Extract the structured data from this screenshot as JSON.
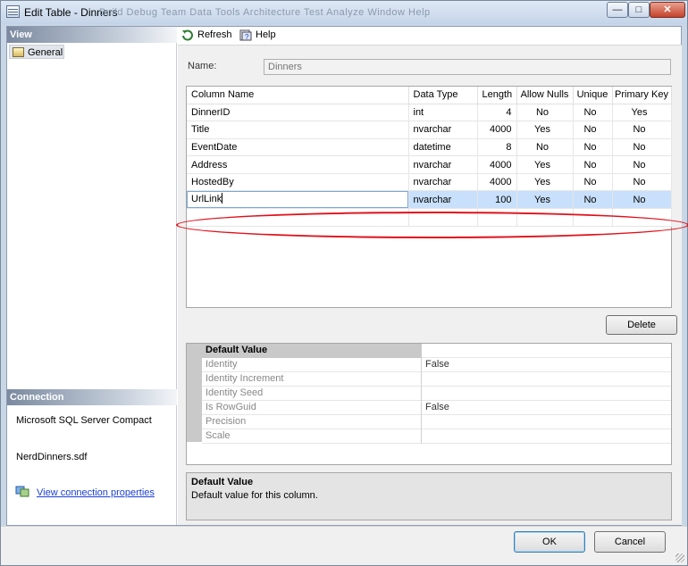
{
  "window": {
    "title": "Edit Table - Dinners",
    "bg_menu_ghost": "Build   Debug   Team   Data   Tools   Architecture   Test   Analyze   Window   Help"
  },
  "left": {
    "view_header": "View",
    "general_item": "General",
    "connection_header": "Connection",
    "server": "Microsoft SQL Server Compact",
    "file": "NerdDinners.sdf",
    "connection_link": "View connection properties"
  },
  "toolbar": {
    "refresh": "Refresh",
    "help": "Help"
  },
  "name": {
    "label": "Name:",
    "value": "Dinners"
  },
  "columns_grid": {
    "headers": [
      "Column Name",
      "Data Type",
      "Length",
      "Allow Nulls",
      "Unique",
      "Primary Key"
    ],
    "rows": [
      {
        "name": "DinnerID",
        "type": "int",
        "length": "4",
        "nulls": "No",
        "unique": "No",
        "pk": "Yes"
      },
      {
        "name": "Title",
        "type": "nvarchar",
        "length": "4000",
        "nulls": "Yes",
        "unique": "No",
        "pk": "No"
      },
      {
        "name": "EventDate",
        "type": "datetime",
        "length": "8",
        "nulls": "No",
        "unique": "No",
        "pk": "No"
      },
      {
        "name": "Address",
        "type": "nvarchar",
        "length": "4000",
        "nulls": "Yes",
        "unique": "No",
        "pk": "No"
      },
      {
        "name": "HostedBy",
        "type": "nvarchar",
        "length": "4000",
        "nulls": "Yes",
        "unique": "No",
        "pk": "No"
      },
      {
        "name": "UrlLink",
        "type": "nvarchar",
        "length": "100",
        "nulls": "Yes",
        "unique": "No",
        "pk": "No"
      }
    ]
  },
  "delete_button": "Delete",
  "properties": {
    "rows": [
      {
        "name": "Default Value",
        "value": ""
      },
      {
        "name": "Identity",
        "value": "False"
      },
      {
        "name": "Identity Increment",
        "value": ""
      },
      {
        "name": "Identity Seed",
        "value": ""
      },
      {
        "name": "Is RowGuid",
        "value": "False"
      },
      {
        "name": "Precision",
        "value": ""
      },
      {
        "name": "Scale",
        "value": ""
      }
    ]
  },
  "description": {
    "title": "Default Value",
    "text": "Default value for this column."
  },
  "footer": {
    "ok": "OK",
    "cancel": "Cancel"
  },
  "colors": {
    "selection": "#c8e0fb",
    "highlight_ring": "#e0101a",
    "link": "#1a3fd0"
  }
}
